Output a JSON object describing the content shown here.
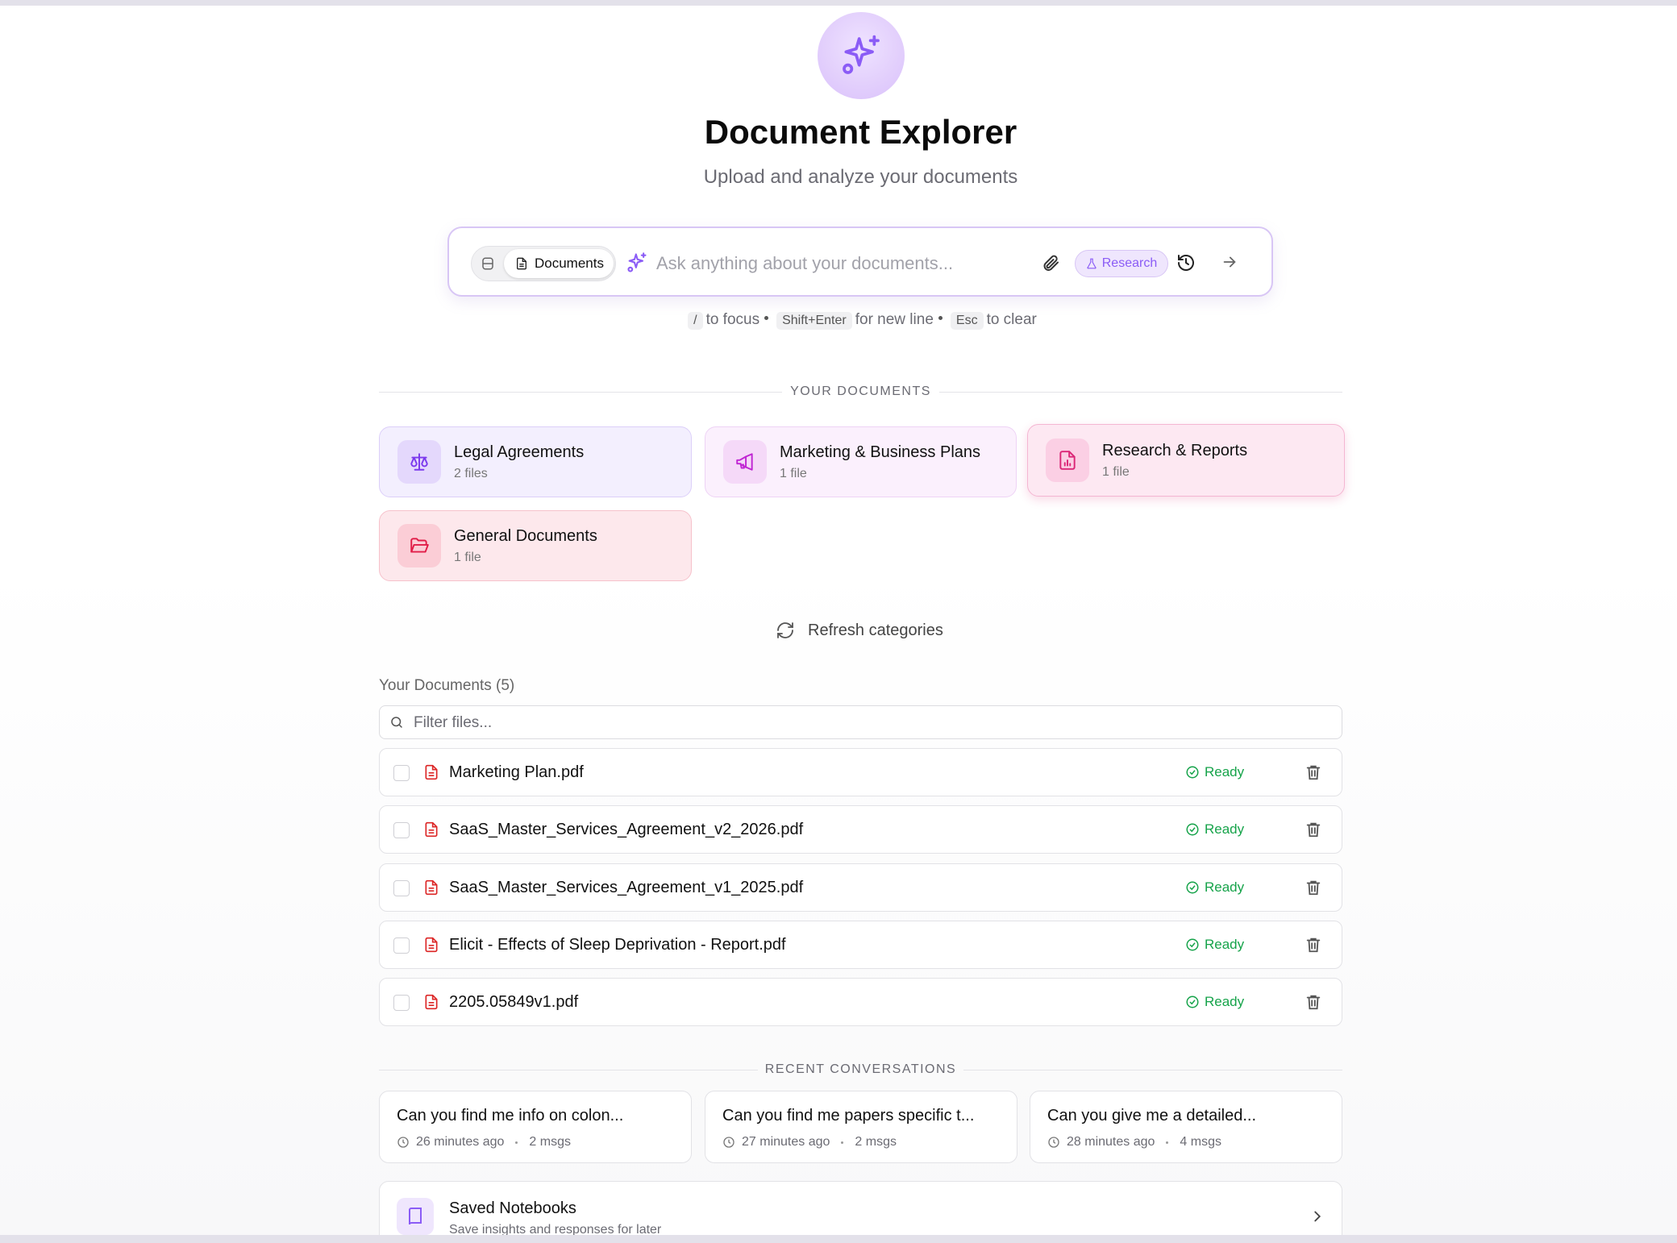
{
  "app": {
    "title": "Document Explorer",
    "subtitle": "Upload and analyze your documents"
  },
  "search": {
    "scope_label": "Documents",
    "placeholder": "Ask anything about your documents...",
    "research_label": "Research"
  },
  "hints": {
    "focus_key": "/",
    "focus_text": "to focus",
    "newline_key": "Shift+Enter",
    "newline_text": "for new line",
    "clear_key": "Esc",
    "clear_text": "to clear"
  },
  "categories_section": {
    "label": "YOUR DOCUMENTS",
    "items": [
      {
        "title": "Legal Agreements",
        "count": "2 files",
        "icon": "scale-icon",
        "color": "#7c3aed"
      },
      {
        "title": "Marketing & Business Plans",
        "count": "1 file",
        "icon": "megaphone-icon",
        "color": "#c026d3"
      },
      {
        "title": "Research & Reports",
        "count": "1 file",
        "icon": "file-chart-icon",
        "color": "#db2777"
      },
      {
        "title": "General Documents",
        "count": "1 file",
        "icon": "folder-open-icon",
        "color": "#e11d48"
      }
    ],
    "refresh_label": "Refresh categories"
  },
  "documents": {
    "heading": "Your Documents (5)",
    "filter_placeholder": "Filter files...",
    "files": [
      {
        "name": "Marketing Plan.pdf",
        "status": "Ready"
      },
      {
        "name": "SaaS_Master_Services_Agreement_v2_2026.pdf",
        "status": "Ready"
      },
      {
        "name": "SaaS_Master_Services_Agreement_v1_2025.pdf",
        "status": "Ready"
      },
      {
        "name": "Elicit - Effects of Sleep Deprivation - Report.pdf",
        "status": "Ready"
      },
      {
        "name": "2205.05849v1.pdf",
        "status": "Ready"
      }
    ]
  },
  "conversations": {
    "label": "RECENT CONVERSATIONS",
    "items": [
      {
        "title": "Can you find me info on colon...",
        "time": "26 minutes ago",
        "msgs": "2 msgs"
      },
      {
        "title": "Can you find me papers specific t...",
        "time": "27 minutes ago",
        "msgs": "2 msgs"
      },
      {
        "title": "Can you give me a detailed...",
        "time": "28 minutes ago",
        "msgs": "4 msgs"
      }
    ]
  },
  "notebooks": {
    "title": "Saved Notebooks",
    "subtitle": "Save insights and responses for later"
  },
  "colors": {
    "accent": "#8b5cf6",
    "ready": "#16a34a",
    "pdf_red": "#dc2626"
  }
}
